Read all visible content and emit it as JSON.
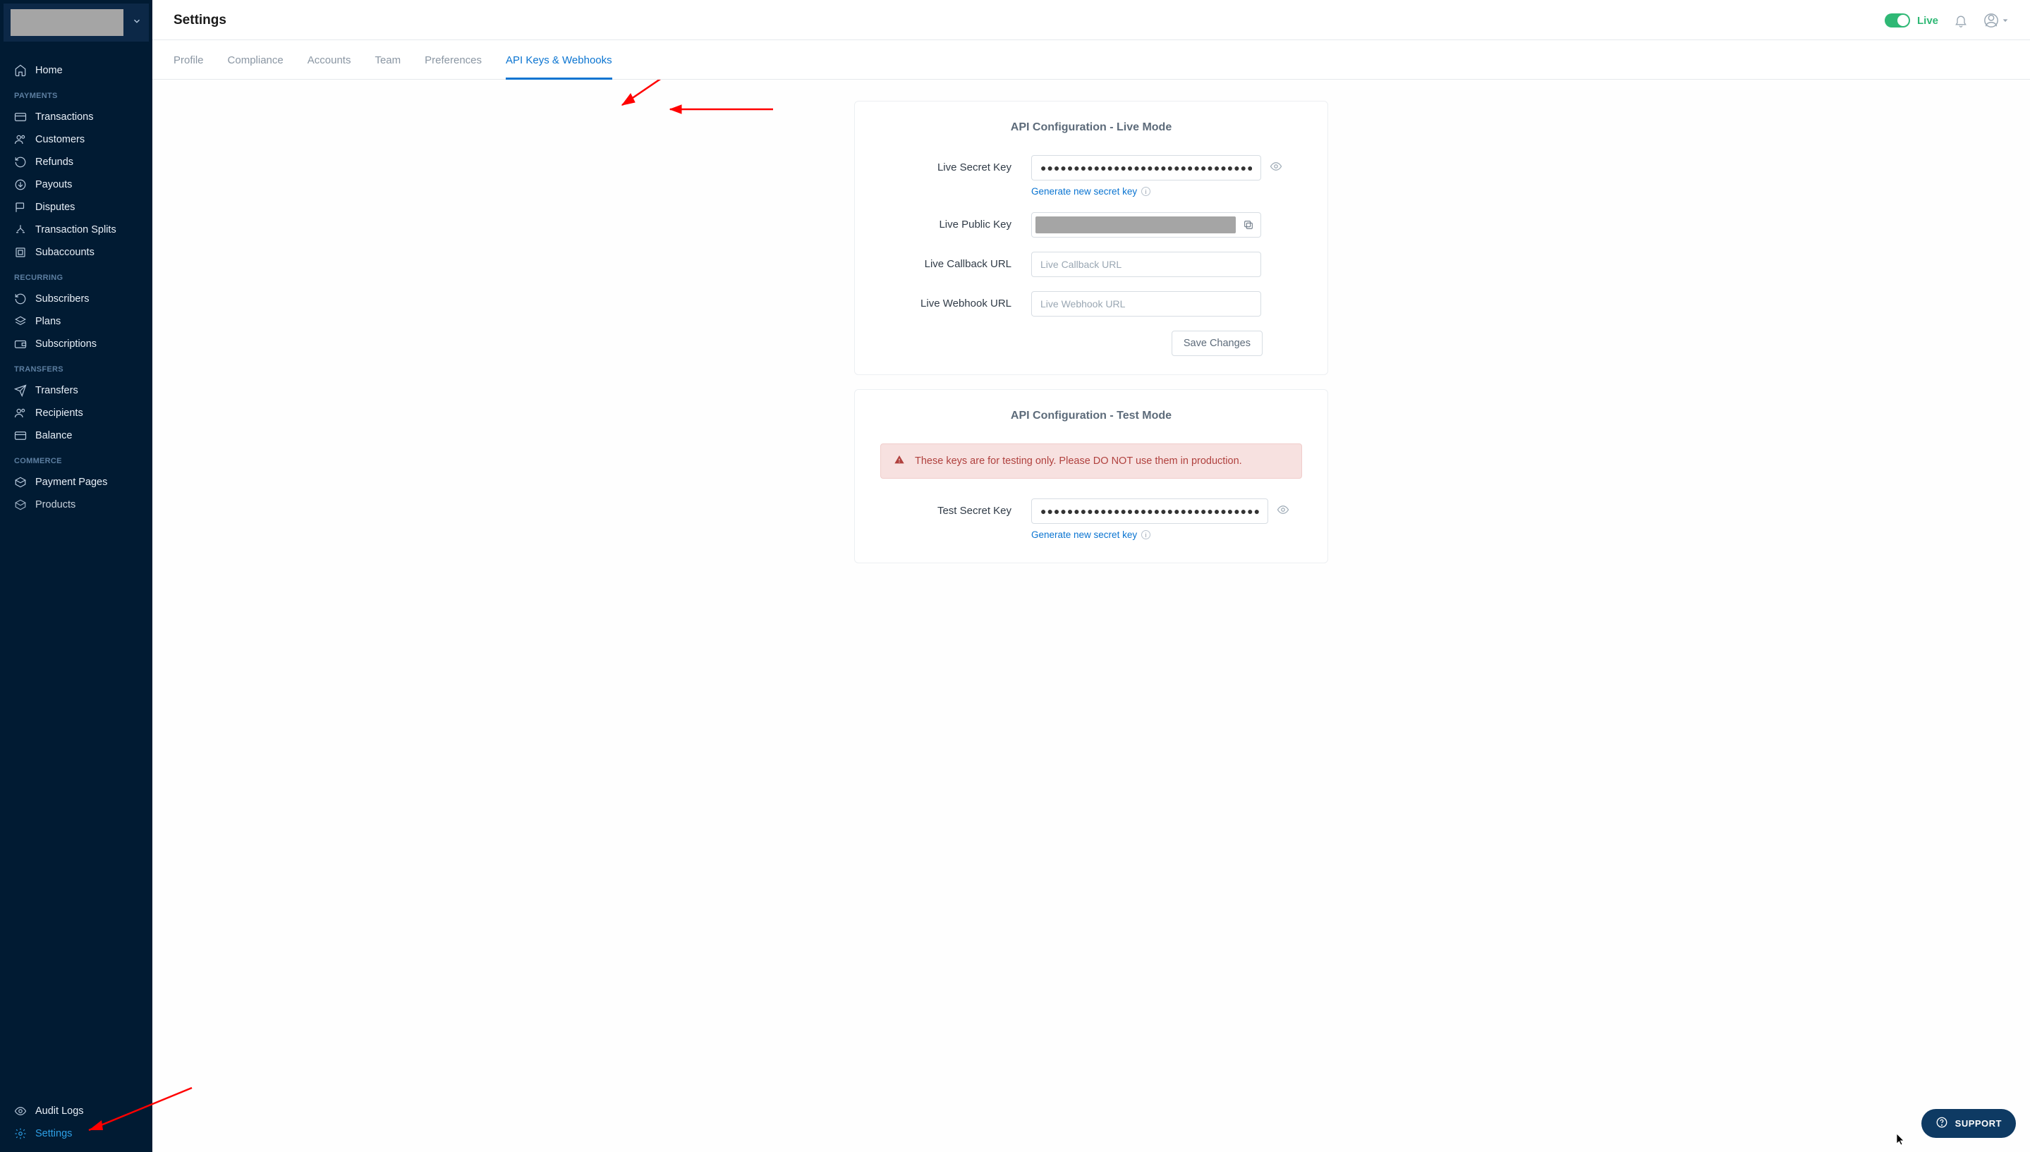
{
  "sidebar": {
    "home": "Home",
    "sections": [
      {
        "title": "PAYMENTS",
        "items": [
          "Transactions",
          "Customers",
          "Refunds",
          "Payouts",
          "Disputes",
          "Transaction Splits",
          "Subaccounts"
        ]
      },
      {
        "title": "RECURRING",
        "items": [
          "Subscribers",
          "Plans",
          "Subscriptions"
        ]
      },
      {
        "title": "TRANSFERS",
        "items": [
          "Transfers",
          "Recipients",
          "Balance"
        ]
      },
      {
        "title": "COMMERCE",
        "items": [
          "Payment Pages",
          "Products"
        ]
      }
    ],
    "bottom": [
      "Audit Logs",
      "Settings"
    ]
  },
  "page_title": "Settings",
  "mode_label": "Live",
  "tabs": [
    "Profile",
    "Compliance",
    "Accounts",
    "Team",
    "Preferences",
    "API Keys & Webhooks"
  ],
  "active_tab_index": 5,
  "live_card": {
    "title": "API Configuration - Live Mode",
    "secret_label": "Live Secret Key",
    "secret_value": "●●●●●●●●●●●●●●●●●●●●●●●●●●●●●●●●●●●●●●●●●●●●●●●●",
    "generate_link": "Generate new secret key",
    "public_label": "Live Public Key",
    "callback_label": "Live Callback URL",
    "callback_placeholder": "Live Callback URL",
    "webhook_label": "Live Webhook URL",
    "webhook_placeholder": "Live Webhook URL",
    "save_label": "Save Changes"
  },
  "test_card": {
    "title": "API Configuration - Test Mode",
    "warning": "These keys are for testing only. Please DO NOT use them in production.",
    "secret_label": "Test Secret Key",
    "secret_value": "●●●●●●●●●●●●●●●●●●●●●●●●●●●●●●●●●●●●●●●●●●●●●●●",
    "generate_link": "Generate new secret key"
  },
  "support_label": "SUPPORT"
}
